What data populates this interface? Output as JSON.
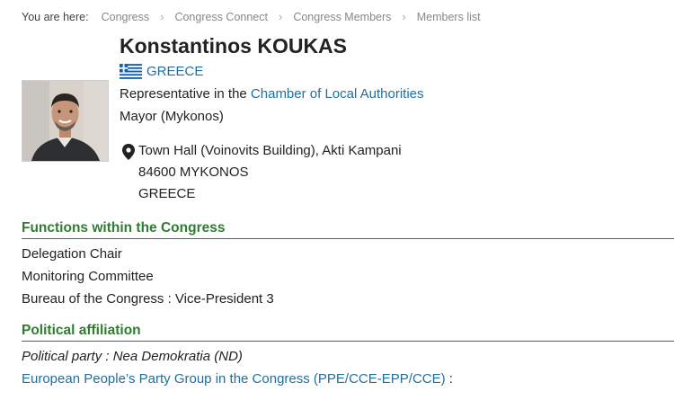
{
  "breadcrumb": {
    "lead": "You are here:",
    "items": [
      "Congress",
      "Congress Connect",
      "Congress Members",
      "Members list"
    ]
  },
  "member": {
    "name": "Konstantinos KOUKAS",
    "country": "GREECE",
    "role_prefix": "Representative in the ",
    "role_link": "Chamber of Local Authorities",
    "position": "Mayor (Mykonos)",
    "address": [
      "Town Hall (Voinovits Building), Akti Kampani",
      "84600 MYKONOS",
      "GREECE"
    ]
  },
  "functions": {
    "title": "Functions within the Congress",
    "items": [
      "Delegation Chair",
      "Monitoring Committee",
      "Bureau of the Congress : Vice-President 3"
    ]
  },
  "political": {
    "title": "Political affiliation",
    "party": "Political party : Nea Demokratia (ND)",
    "group_link": "European People’s Party Group in the Congress (PPE/CCE-EPP/CCE)",
    "group_suffix": " :"
  },
  "colors": {
    "link": "#1f6fa0",
    "section_green": "#2f7d2e",
    "flag_blue": "#0d5eaf"
  }
}
